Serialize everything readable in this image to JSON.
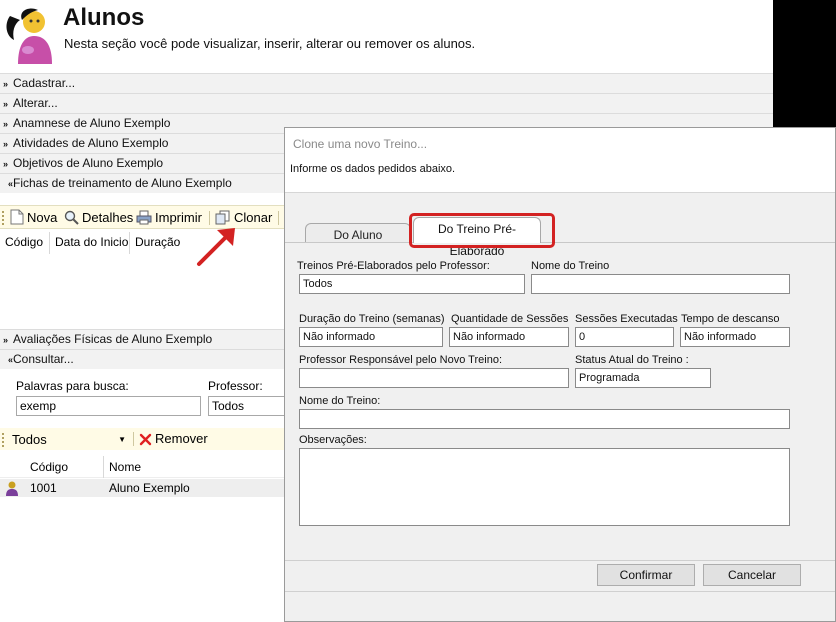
{
  "header": {
    "title": "Alunos",
    "subtitle": "Nesta seção você pode visualizar, inserir, alterar ou remover os alunos."
  },
  "sections": {
    "cadastrar": "Cadastrar...",
    "alterar": "Alterar...",
    "anamnese": "Anamnese de Aluno Exemplo",
    "atividades": "Atividades de Aluno Exemplo",
    "objetivos": "Objetivos de Aluno Exemplo",
    "fichas": "Fichas de treinamento de Aluno Exemplo",
    "avaliacoes": "Avaliações Físicas de Aluno Exemplo",
    "consultar": "Consultar..."
  },
  "toolbar": {
    "nova": "Nova",
    "detalhes": "Detalhes",
    "imprimir": "Imprimir",
    "clonar": "Clonar"
  },
  "fichas_columns": [
    "Código",
    "Data do Inicio",
    "Duração"
  ],
  "search": {
    "keywords_label": "Palavras para busca:",
    "keywords_value": "exemp",
    "professor_label": "Professor:",
    "professor_value": "Todos"
  },
  "filter": {
    "selected": "Todos",
    "remove_label": "Remover"
  },
  "students": {
    "columns": [
      "Código",
      "Nome"
    ],
    "rows": [
      {
        "codigo": "1001",
        "nome": "Aluno Exemplo"
      }
    ]
  },
  "dialog": {
    "title": "Clone uma novo Treino...",
    "info": "Informe os dados pedidos abaixo.",
    "tabs": [
      "Do Aluno",
      "Do Treino Pré-Elaborado"
    ],
    "active_tab": "Do Treino Pré-Elaborado",
    "fields": {
      "treinos_prof_label": "Treinos Pré-Elaborados pelo Professor:",
      "treinos_prof_value": "Todos",
      "nome_treino_top_label": "Nome do Treino",
      "nome_treino_top_value": "",
      "duracao_label": "Duração do Treino (semanas)",
      "duracao_value": "Não informado",
      "quantidade_label": "Quantidade de Sessões",
      "quantidade_value": "Não informado",
      "sessoes_exec_label": "Sessões Executadas",
      "sessoes_exec_value": "0",
      "descanso_label": "Tempo de descanso",
      "descanso_value": "Não informado",
      "professor_resp_label": "Professor Responsável pelo Novo Treino:",
      "professor_resp_value": "",
      "status_label": "Status Atual do Treino :",
      "status_value": "Programada",
      "nome_treino_label": "Nome do Treino:",
      "nome_treino_value": "",
      "observacoes_label": "Observações:",
      "observacoes_value": ""
    },
    "buttons": {
      "confirm": "Confirmar",
      "cancel": "Cancelar"
    }
  },
  "colors": {
    "toolbar_bg": "#fffbe6",
    "highlight_red": "#d32222",
    "arrow_red": "#d32222",
    "remove_x": "#e02020"
  }
}
